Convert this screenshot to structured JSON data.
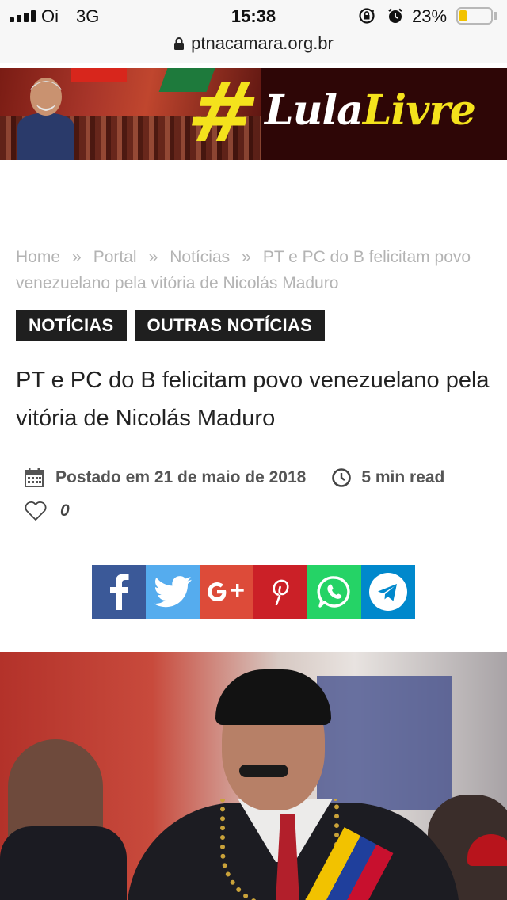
{
  "status_bar": {
    "carrier": "Oi",
    "network": "3G",
    "time": "15:38",
    "battery_percent": "23%",
    "battery_level": 0.23,
    "icons": [
      "signal-icon",
      "orientation-lock-icon",
      "alarm-icon",
      "battery-icon"
    ]
  },
  "browser": {
    "url": "ptnacamara.org.br",
    "lock_icon": "padlock-icon"
  },
  "banner": {
    "hashtag": "#",
    "text_part1": "Lula",
    "text_part2": "Livre",
    "accent_color": "#f4e21c"
  },
  "breadcrumb": {
    "items": [
      "Home",
      "Portal",
      "Notícias",
      "PT e PC do B felicitam povo venezuelano pela vitória de Nicolás Maduro"
    ],
    "separator": "»"
  },
  "tags": [
    "NOTÍCIAS",
    "OUTRAS NOTÍCIAS"
  ],
  "article": {
    "title": "PT e PC do B felicitam povo venezuelano pela vitória de Nicolás Maduro",
    "posted": "Postado em 21 de maio de 2018",
    "read_time": "5 min read",
    "likes": "0"
  },
  "share": {
    "buttons": [
      {
        "name": "facebook",
        "icon": "facebook-icon",
        "color": "#3b5998"
      },
      {
        "name": "twitter",
        "icon": "twitter-icon",
        "color": "#55acee"
      },
      {
        "name": "google-plus",
        "icon": "google-plus-icon",
        "color": "#dd4b39"
      },
      {
        "name": "pinterest",
        "icon": "pinterest-icon",
        "color": "#cb2027"
      },
      {
        "name": "whatsapp",
        "icon": "whatsapp-icon",
        "color": "#25d366"
      },
      {
        "name": "telegram",
        "icon": "telegram-icon",
        "color": "#0088cc"
      }
    ]
  }
}
